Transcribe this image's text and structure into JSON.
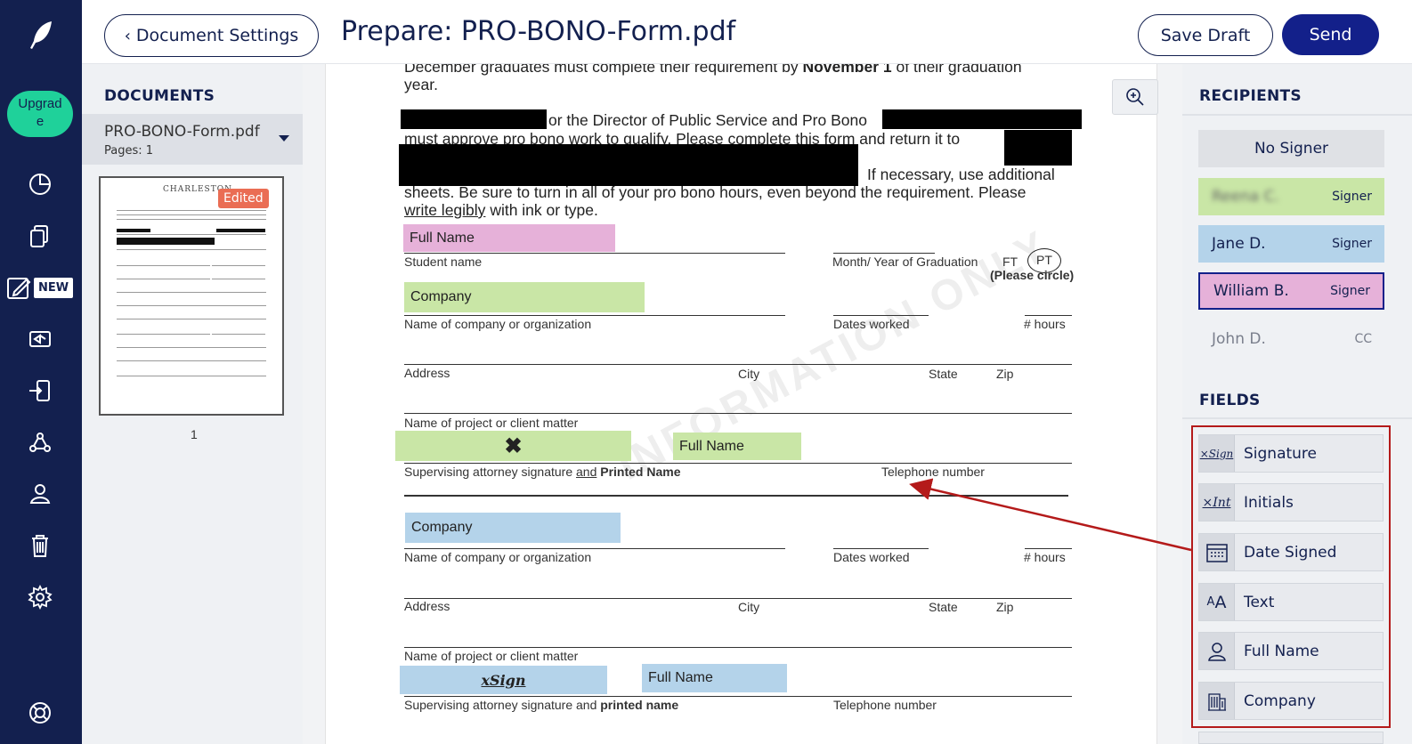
{
  "nav": {
    "upgrade_label": "Upgrad\ne",
    "new_badge": "NEW"
  },
  "header": {
    "back_label": "Document Settings",
    "title": "Prepare: PRO-BONO-Form.pdf",
    "save_draft": "Save Draft",
    "send": "Send"
  },
  "documents": {
    "heading": "DOCUMENTS",
    "file_name": "PRO-BONO-Form.pdf",
    "pages": "Pages: 1",
    "thumb_header": "CHARLESTON",
    "edited_badge": "Edited",
    "page_number": "1"
  },
  "pdf": {
    "line1": "December graduates must complete their requirement by",
    "line1_bold": "November 1",
    "line1_end": "of their graduation",
    "line2": "year.",
    "line3": "or the Director of Public Service and Pro Bono",
    "line4": "must approve pro bono work to qualify. Please complete this form and return it to",
    "line5": "If necessary, use additional",
    "line6": "sheets. Be sure to turn in all of your pro bono hours, even beyond the requirement. Please",
    "line7_u": "write legibly",
    "line7": "with ink or type.",
    "student_name": "Student name",
    "month_year": "Month/ Year of Graduation",
    "ft": "FT",
    "pt": "PT",
    "please_circle": "(Please circle)",
    "company_label": "Name of company or organization",
    "dates_worked": "Dates worked",
    "hours": "# hours",
    "address": "Address",
    "city": "City",
    "state": "State",
    "zip": "Zip",
    "project": "Name of project or client matter",
    "supervising_1": "Supervising attorney signature",
    "supervising_and": "and",
    "supervising_printed": "Printed Name",
    "telephone": "Telephone number",
    "company_label_2": "Name of company or organization",
    "dates_worked_2": "Dates worked",
    "hours_2": "# hours",
    "address_2": "Address",
    "city_2": "City",
    "state_2": "State",
    "zip_2": "Zip",
    "project_2": "Name of project or client matter",
    "supervising_2": "Supervising attorney signature and",
    "supervising_2_bold": "printed name",
    "telephone_2": "Telephone number",
    "watermark": "INFORMATION ONLY"
  },
  "placed_fields": {
    "full_name_pink": "Full Name",
    "company_green": "Company",
    "signature_mark": "✖",
    "full_name_green": "Full Name",
    "company_blue": "Company",
    "signature_blue": "xSign",
    "full_name_blue": "Full Name"
  },
  "recipients": {
    "heading": "RECIPIENTS",
    "no_signer": "No Signer",
    "items": [
      {
        "name": "Reena C.",
        "role": "Signer",
        "color": "#c9e6a6"
      },
      {
        "name": "Jane D.",
        "role": "Signer",
        "color": "#b4d3ea"
      },
      {
        "name": "William B.",
        "role": "Signer",
        "color": "#e6b1d9"
      },
      {
        "name": "John D.",
        "role": "CC",
        "color": "#eff1f4"
      }
    ]
  },
  "fields": {
    "heading": "FIELDS",
    "items": [
      {
        "label": "Signature",
        "icon": "signature-icon"
      },
      {
        "label": "Initials",
        "icon": "initials-icon"
      },
      {
        "label": "Date Signed",
        "icon": "calendar-icon"
      },
      {
        "label": "Text",
        "icon": "text-icon"
      },
      {
        "label": "Full Name",
        "icon": "person-icon"
      },
      {
        "label": "Company",
        "icon": "building-icon"
      }
    ]
  },
  "colors": {
    "navy": "#13204f",
    "upgrade_green": "#1fd19a",
    "annotation_red": "#b41a1a",
    "pink": "#e6b1d9",
    "green": "#c9e6a6",
    "blue": "#b4d3ea"
  }
}
